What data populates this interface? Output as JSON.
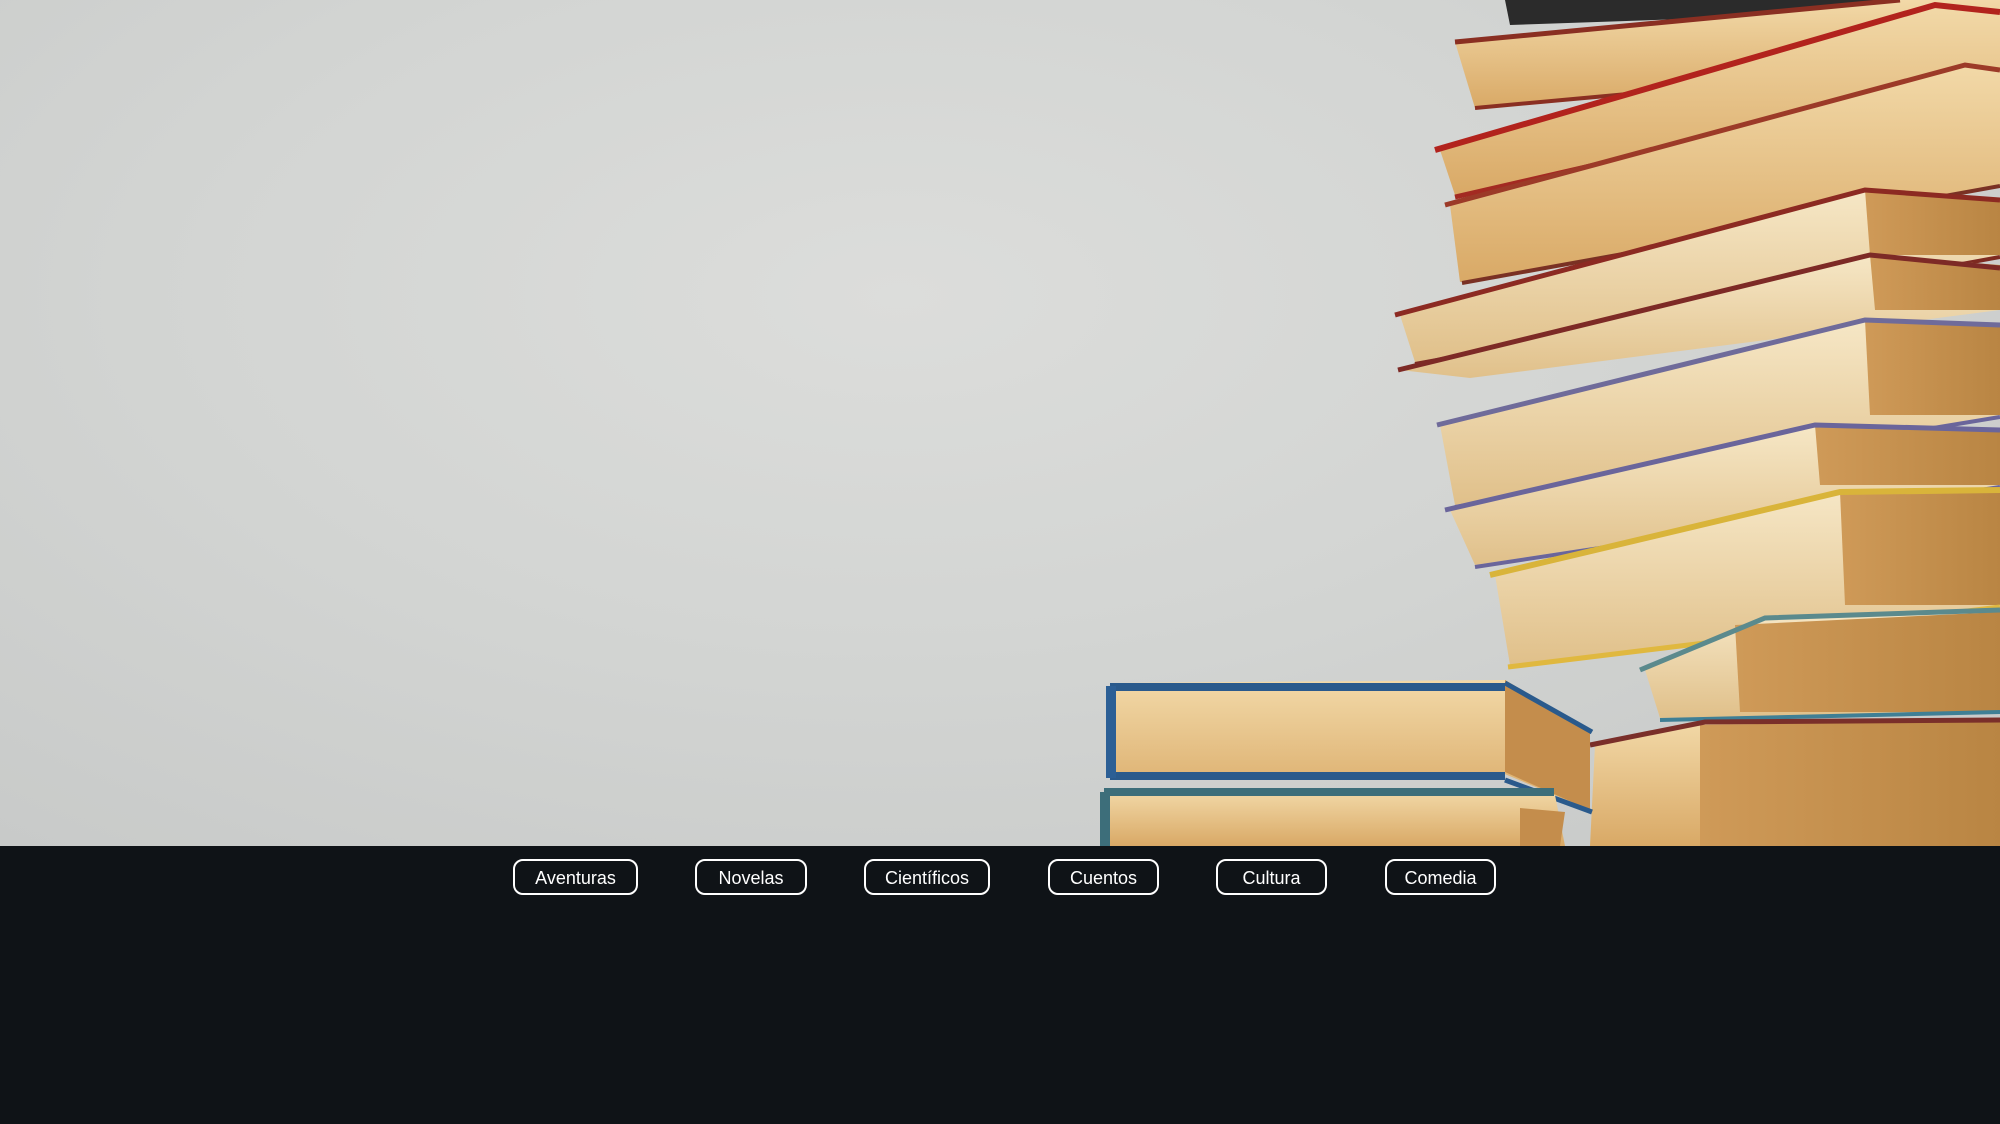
{
  "hero": {
    "image": "stack-of-hardcover-books",
    "background_color": "#d3d5d3"
  },
  "categories": {
    "items": [
      {
        "label": "Aventuras"
      },
      {
        "label": "Novelas"
      },
      {
        "label": "Científicos"
      },
      {
        "label": "Cuentos"
      },
      {
        "label": "Cultura"
      },
      {
        "label": "Comedia"
      }
    ],
    "border_color": "#ffffff",
    "text_color": "#ffffff",
    "bar_color": "#0f1317"
  }
}
